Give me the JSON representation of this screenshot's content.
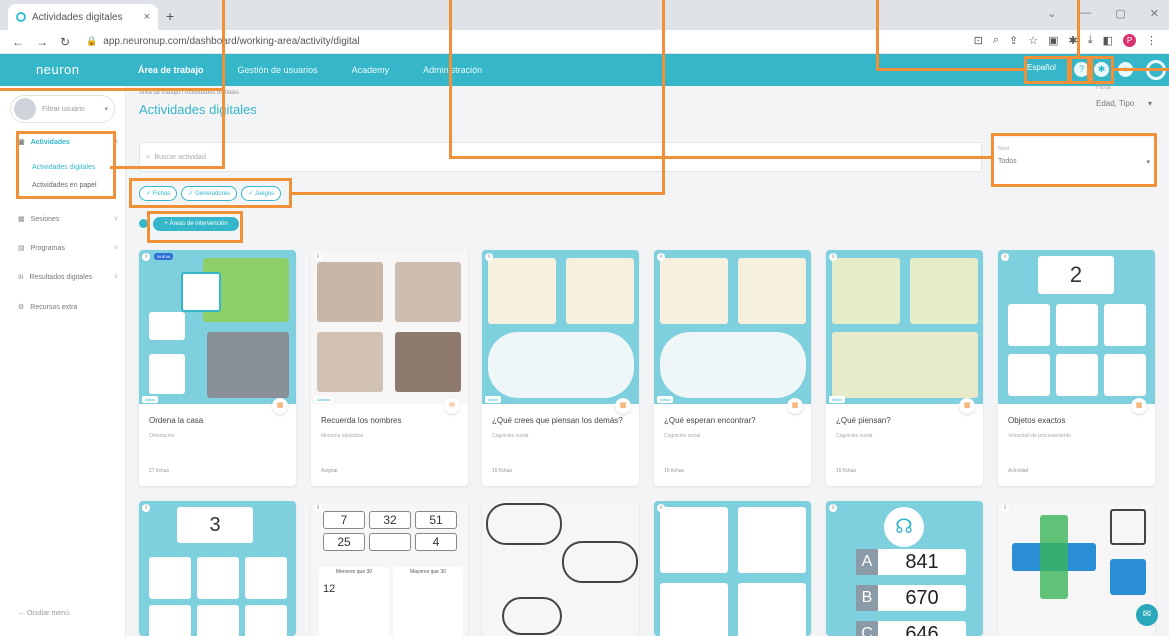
{
  "browser": {
    "tab_title": "Actividades digitales",
    "tab_close": "×",
    "new_tab": "+",
    "url": "app.neuronup.com/dashboard/working-area/activity/digital",
    "window_controls": [
      "⌄",
      "—",
      "▢",
      "✕"
    ]
  },
  "header": {
    "logo": "neuron",
    "nav": [
      "Área de trabajo",
      "Gestión de usuarios",
      "Academy",
      "Administración"
    ],
    "language": "Español"
  },
  "sidebar": {
    "user_filter": "Filtrar usuario",
    "items": [
      {
        "label": "Actividades",
        "sub": [
          "Actividades digitales",
          "Actividades en papel"
        ]
      },
      {
        "label": "Sesiones"
      },
      {
        "label": "Programas"
      },
      {
        "label": "Resultados digitales"
      },
      {
        "label": "Recursos extra"
      }
    ],
    "hide_menu": "Ocultar menú"
  },
  "main": {
    "breadcrumb": "Área de trabajo / Actividades digitales",
    "title": "Actividades digitales",
    "filter_label": "Filtrar",
    "filter_value": "Edad, Tipo",
    "search_placeholder": "Buscar actividad",
    "select_label": "Nivel",
    "select_value": "Todos",
    "chips": [
      "✓ Fichas",
      "✓ Generadores",
      "✓ Juegos"
    ],
    "areas_button": "+ Áreas de intervención"
  },
  "cards": [
    {
      "title": "Ordena la casa",
      "sub": "Orientación",
      "foot": "27 fichas",
      "badge": "Niños",
      "new": "NUEVA"
    },
    {
      "title": "Recuerda los nombres",
      "sub": "Memoria episódica",
      "foot": "Asignar",
      "badge": "Adultos"
    },
    {
      "title": "¿Qué crees que piensan los demás?",
      "sub": "Cognición social",
      "foot": "16 fichas",
      "badge": "Niños"
    },
    {
      "title": "¿Qué esperan encontrar?",
      "sub": "Cognición social",
      "foot": "16 fichas",
      "badge": "Niños"
    },
    {
      "title": "¿Qué piensan?",
      "sub": "Cognición social",
      "foot": "16 fichas",
      "badge": "Niños"
    },
    {
      "title": "Objetos exactos",
      "sub": "Velocidad de procesamiento",
      "foot": "Actividad",
      "badge": ""
    }
  ],
  "row2": {
    "plant_count": "3",
    "numbers": [
      "7",
      "32",
      "51",
      "25",
      "",
      "4"
    ],
    "less_label": "Menores que 30",
    "more_label": "Mayores que 30",
    "picked": "12",
    "letters": [
      "A",
      "B",
      "C"
    ],
    "values": [
      "841",
      "670",
      "646"
    ]
  },
  "card6_count": "2",
  "colors": {
    "accent": "#36b6c9",
    "annotation": "#f0913a"
  }
}
